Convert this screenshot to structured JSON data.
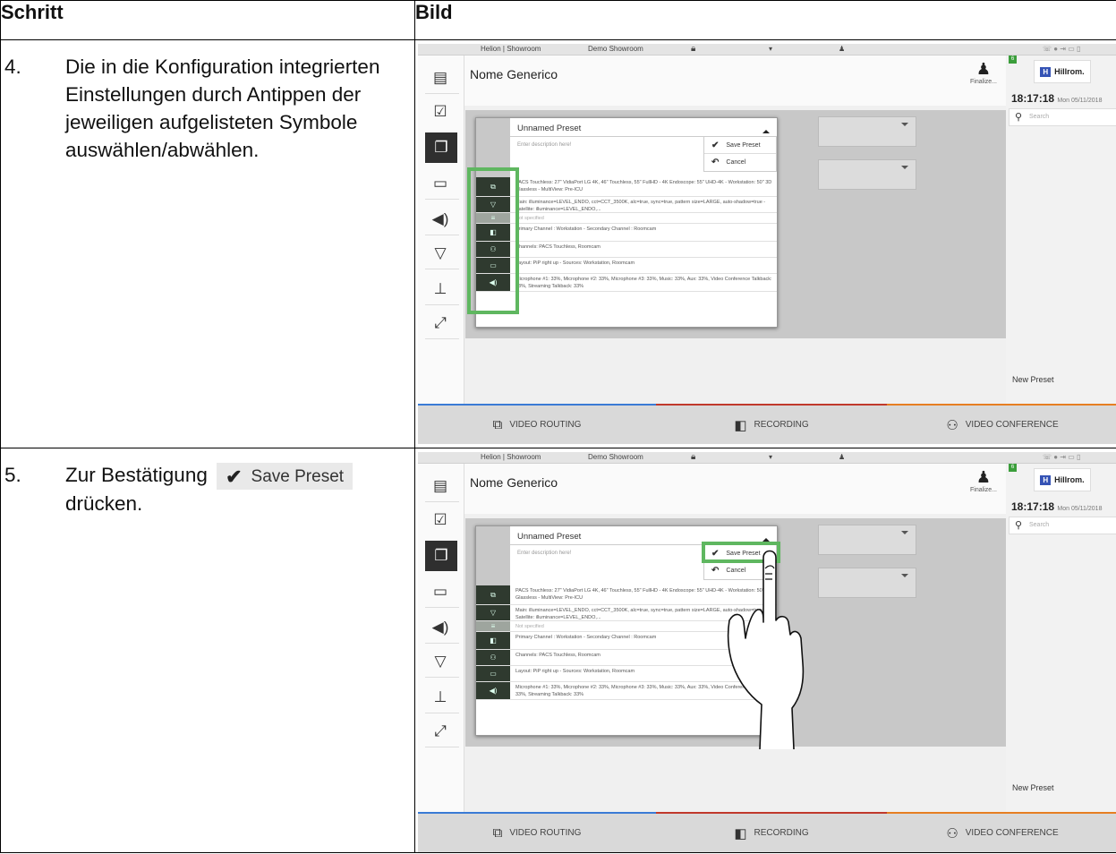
{
  "table": {
    "col1_header": "Schritt",
    "col2_header": "Bild"
  },
  "rows": [
    {
      "num": "4.",
      "text": "Die in die Konfiguration integrierten Einstellungen durch Antippen der jeweiligen aufgelisteten Symbole auswählen/abwählen."
    },
    {
      "num": "5.",
      "text_before": "Zur Bestätigung",
      "button_label": "Save Preset",
      "text_after": "drücken."
    }
  ],
  "ui": {
    "topbar": {
      "location": "Helion | Showroom",
      "room": "Demo Showroom"
    },
    "patient_name": "Nome Generico",
    "finalize_label": "Finalize...",
    "finalize_badge": "6",
    "logo": {
      "mark": "H",
      "text": "Hillrom."
    },
    "time": "18:17:18",
    "date": "Mon 05/11/2018",
    "search_placeholder": "Search",
    "new_preset": "New Preset",
    "preset": {
      "title": "Unnamed Preset",
      "description_placeholder": "Enter description here!",
      "save": "Save Preset",
      "cancel": "Cancel"
    },
    "config_rows": [
      {
        "icon": "monitor-icon",
        "glyph": "⧉",
        "text": "PACS Touchless: 27\" VidiaPort LG 4K, 46\" Touchless, 55\" FullHD - 4K Endoscope: 55\" UHD-4K - Workstation: 50\" 3D Glassless - MultiView: Pre-ICU"
      },
      {
        "icon": "light-icon",
        "glyph": "▽",
        "text": "Main: illuminance=LEVEL_ENDO, cct=CCT_3500K, alc=true, sync=true, pattern size=LARGE, auto-shadow=true - Satellite: illuminance=LEVEL_ENDO,..."
      },
      {
        "icon": "table-icon",
        "glyph": "≡",
        "text": "Not specified",
        "dim": true
      },
      {
        "icon": "camera-icon",
        "glyph": "◧",
        "text": "Primary Channel : Workstation - Secondary Channel : Roomcam"
      },
      {
        "icon": "conference-icon",
        "glyph": "⚇",
        "text": "Channels: PACS Touchless, Roomcam"
      },
      {
        "icon": "layout-icon",
        "glyph": "▭",
        "text": "Layout: PiP right up - Sources: Workstation, Roomcam"
      },
      {
        "icon": "audio-icon",
        "glyph": "◀)",
        "text": "Microphone #1: 33%, Microphone #2: 33%, Microphone #3: 33%, Music: 33%, Aux: 33%, Video Conference Talkback: 33%, Streaming Talkback: 33%"
      }
    ],
    "tabs": [
      "VIDEO ROUTING",
      "RECORDING",
      "VIDEO CONFERENCE"
    ]
  }
}
